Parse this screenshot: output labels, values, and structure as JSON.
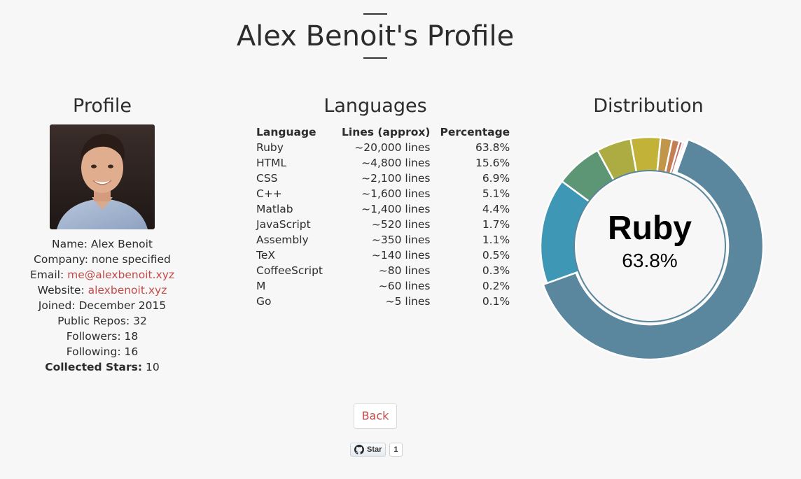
{
  "page": {
    "title": "Alex Benoit's Profile"
  },
  "profile": {
    "heading": "Profile",
    "name_label": "Name:",
    "name": "Alex Benoit",
    "company_label": "Company:",
    "company": "none specified",
    "email_label": "Email:",
    "email": "me@alexbenoit.xyz",
    "website_label": "Website:",
    "website": "alexbenoit.xyz",
    "joined_label": "Joined:",
    "joined": "December 2015",
    "repos_label": "Public Repos:",
    "repos": "32",
    "followers_label": "Followers:",
    "followers": "18",
    "following_label": "Following:",
    "following": "16",
    "stars_label": "Collected Stars:",
    "stars": "10"
  },
  "languages": {
    "heading": "Languages",
    "columns": [
      "Language",
      "Lines (approx)",
      "Percentage"
    ],
    "rows": [
      [
        "Ruby",
        "~20,000 lines",
        "63.8%"
      ],
      [
        "HTML",
        "~4,800 lines",
        "15.6%"
      ],
      [
        "CSS",
        "~2,100 lines",
        "6.9%"
      ],
      [
        "C++",
        "~1,600 lines",
        "5.1%"
      ],
      [
        "Matlab",
        "~1,400 lines",
        "4.4%"
      ],
      [
        "JavaScript",
        "~520 lines",
        "1.7%"
      ],
      [
        "Assembly",
        "~350 lines",
        "1.1%"
      ],
      [
        "TeX",
        "~140 lines",
        "0.5%"
      ],
      [
        "CoffeeScript",
        "~80 lines",
        "0.3%"
      ],
      [
        "M",
        "~60 lines",
        "0.2%"
      ],
      [
        "Go",
        "~5 lines",
        "0.1%"
      ]
    ]
  },
  "distribution": {
    "heading": "Distribution",
    "center_label": "Ruby",
    "center_value": "63.8%"
  },
  "chart_data": {
    "type": "pie",
    "categories": [
      "Ruby",
      "HTML",
      "CSS",
      "C++",
      "Matlab",
      "JavaScript",
      "Assembly",
      "TeX",
      "CoffeeScript",
      "M",
      "Go"
    ],
    "values": [
      63.8,
      15.6,
      6.9,
      5.1,
      4.4,
      1.7,
      1.1,
      0.5,
      0.3,
      0.2,
      0.1
    ],
    "colors": [
      "#5a879e",
      "#3d97b5",
      "#5c9675",
      "#adac42",
      "#c2b338",
      "#c1964a",
      "#c47e53",
      "#c26f68",
      "#b8546f",
      "#a65a7a",
      "#8d6a85"
    ],
    "highlighted": "Ruby"
  },
  "actions": {
    "back_label": "Back",
    "star_label": "Star",
    "star_count": "1"
  }
}
